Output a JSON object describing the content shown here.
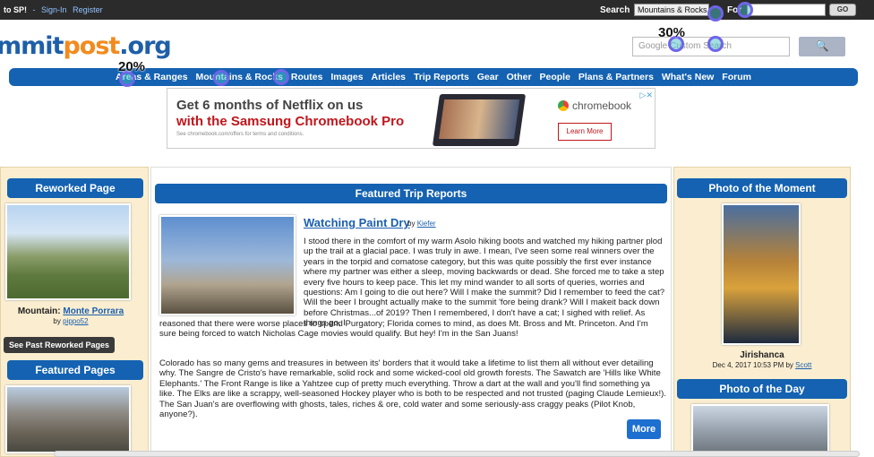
{
  "topbar": {
    "welcome": "to SP!",
    "signin": "Sign-In",
    "register": "Register",
    "search_label": "Search",
    "search_select": "Mountains & Rocks",
    "for_label": "For",
    "go": "GO"
  },
  "header": {
    "logo_a": "mmit",
    "logo_b": "post",
    "logo_c": ".org",
    "search_placeholder": "Google Custom Search",
    "search_button": "🔍"
  },
  "nav": [
    "Areas & Ranges",
    "Mountains & Rocks",
    "Routes",
    "Images",
    "Articles",
    "Trip Reports",
    "Gear",
    "Other",
    "People",
    "Plans & Partners",
    "What's New",
    "Forum"
  ],
  "ad": {
    "line1": "Get 6 months of Netflix on us",
    "line2": "with the Samsung Chromebook Pro",
    "fine": "See chromebook.com/offers for terms and conditions.",
    "brand": "chromebook",
    "cta": "Learn More",
    "close": "▷✕"
  },
  "left": {
    "reworked_title": "Reworked Page",
    "caption_pre": "Mountain:",
    "caption_link": "Monte Porrara",
    "by": "by",
    "author": "pippo52",
    "past_button": "See Past Reworked Pages",
    "featured_title": "Featured Pages"
  },
  "main": {
    "section_title": "Featured Trip Reports",
    "report_title": "Watching Paint Dry",
    "report_by": "by",
    "report_author": "Kiefer",
    "para1": "I stood there in the comfort of my warm Asolo hiking boots and watched my hiking partner plod up the trail at a glacial pace. I was truly in awe. I mean, I've seen some real winners over the years in the torpid and comatose category, but this was quite possibly the first ever instance where my partner was either a sleep, moving backwards or dead. She forced me to take a step every five hours to keep pace. This let my mind wander to all sorts of queries, worries and questions: Am I going to die out here? Will I make the summit? Did I remember to feed the cat? Will the beer I brought actually make to the summit 'fore being drank? Will I makeit back down before Christmas...of 2019? Then I remembered, I don't have a cat; I sighed with relief. As things go, I",
    "para1b": "reasoned that there were worse places to spend Purgatory; Florida comes to mind, as does Mt. Bross and Mt. Princeton. And I'm sure being forced to watch Nicholas Cage movies would qualify. But hey! I'm in the San Juans!",
    "para2": "Colorado has so many gems and treasures in between its' borders that it would take a lifetime to list them all without ever detailing why. The Sangre de Cristo's have remarkable, solid rock and some wicked-cool old growth forests. The Sawatch are 'Hills like White Elephants.' The Front Range is like a Yahtzee cup of pretty much everything. Throw a dart at the wall and you'll find something ya like. The Elks are like a scrappy, well-seasoned Hockey player who is both to be respected and not trusted (paging Claude Lemieux!). The San Juan's are overflowing with ghosts, tales, riches & ore, cold water and some seriously-ass craggy peaks (Pilot Knob, anyone?).",
    "more": "More"
  },
  "right": {
    "moment_title": "Photo of the Moment",
    "moment_name": "Jirishanca",
    "moment_date": "Dec 4, 2017 10:53 PM by",
    "moment_author": "Scott",
    "day_title": "Photo of the Day"
  },
  "overlays": {
    "badge1": "20%",
    "badge2": "30%"
  },
  "colors": {
    "nav_blue": "#1462b1",
    "panel_bg": "#fbeed0",
    "accent_orange": "#f28b1e"
  }
}
